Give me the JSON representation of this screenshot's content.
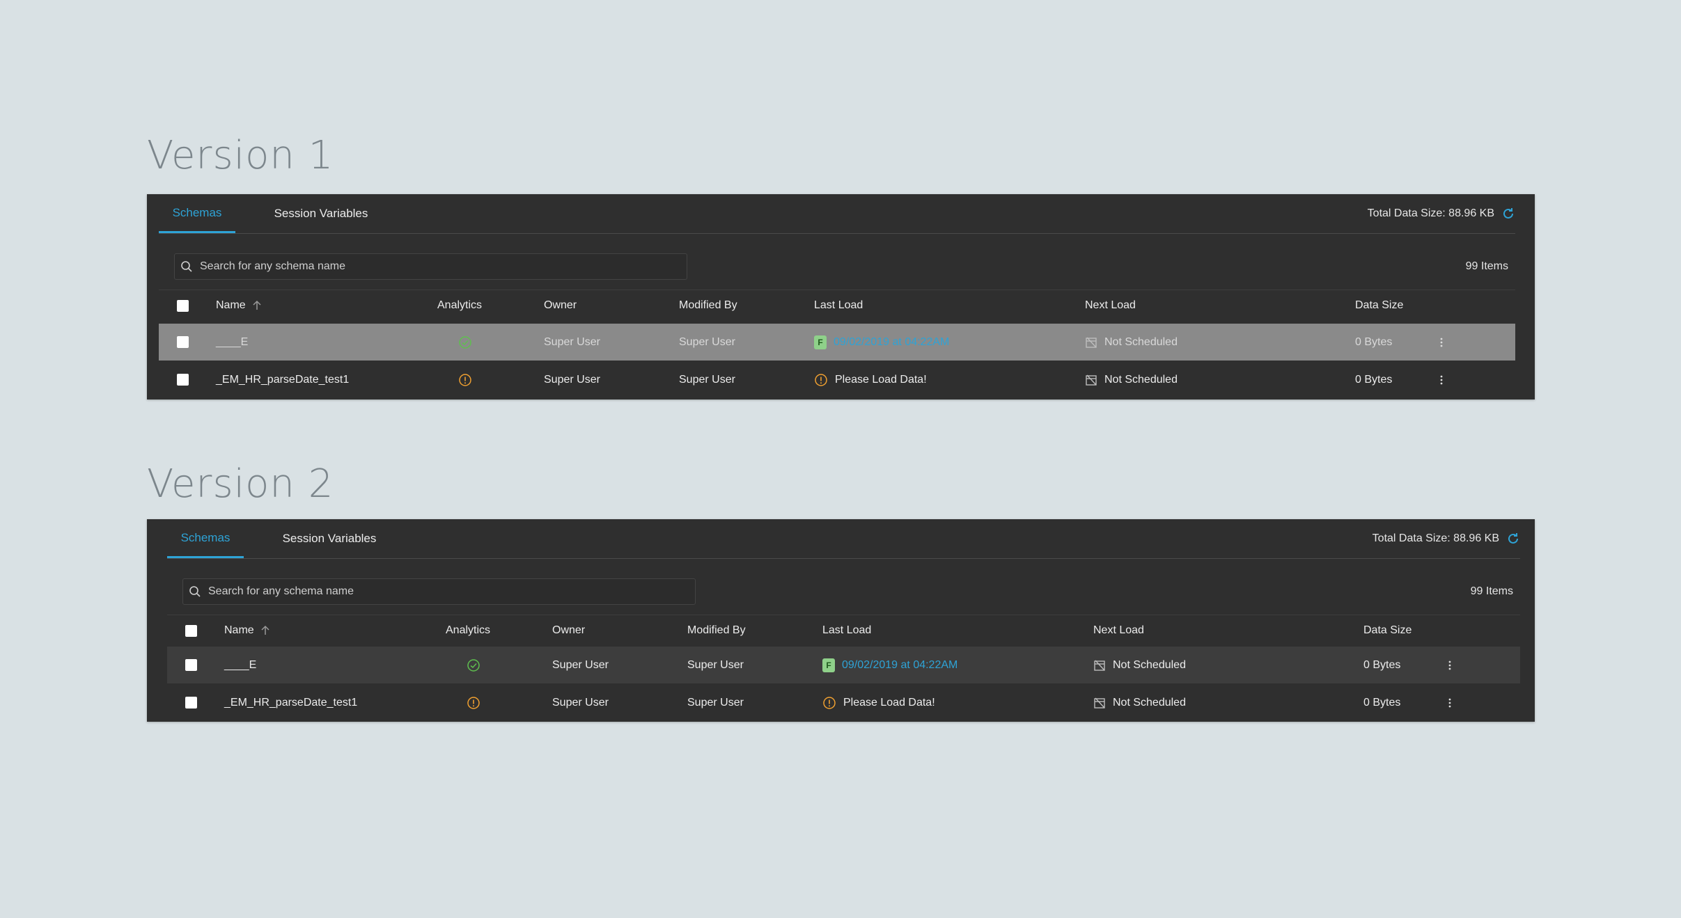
{
  "versions": [
    {
      "title": "Version 1",
      "tabs": [
        "Schemas",
        "Session Variables"
      ],
      "total_size": "Total Data Size: 88.96 KB",
      "search_placeholder": "Search for any schema name",
      "items_count": "99 Items",
      "columns": {
        "name": "Name",
        "analytics": "Analytics",
        "owner": "Owner",
        "modified_by": "Modified By",
        "last_load": "Last Load",
        "next_load": "Next Load",
        "data_size": "Data Size"
      },
      "rows": [
        {
          "name": "____E",
          "analytics_status": "check-circle-icon",
          "owner": "Super User",
          "modified_by": "Super User",
          "last_load_icon_letter": "F",
          "last_load": "09/02/2019 at 04:22AM",
          "next_load": "Not Scheduled",
          "data_size": "0 Bytes"
        },
        {
          "name": "_EM_HR_parseDate_test1",
          "analytics_status": "warning-circle-icon",
          "owner": "Super User",
          "modified_by": "Super User",
          "last_load": "Please Load Data!",
          "next_load": "Not Scheduled",
          "data_size": "0 Bytes"
        }
      ]
    },
    {
      "title": "Version 2",
      "tabs": [
        "Schemas",
        "Session Variables"
      ],
      "total_size": "Total Data Size: 88.96 KB",
      "search_placeholder": "Search for any schema name",
      "items_count": "99 Items",
      "columns": {
        "name": "Name",
        "analytics": "Analytics",
        "owner": "Owner",
        "modified_by": "Modified By",
        "last_load": "Last Load",
        "next_load": "Next Load",
        "data_size": "Data Size"
      },
      "rows": [
        {
          "name": "____E",
          "analytics_status": "check-circle-icon",
          "owner": "Super User",
          "modified_by": "Super User",
          "last_load_icon_letter": "F",
          "last_load": "09/02/2019 at 04:22AM",
          "next_load": "Not Scheduled",
          "data_size": "0 Bytes"
        },
        {
          "name": "_EM_HR_parseDate_test1",
          "analytics_status": "warning-circle-icon",
          "owner": "Super User",
          "modified_by": "Super User",
          "last_load": "Please Load Data!",
          "next_load": "Not Scheduled",
          "data_size": "0 Bytes"
        }
      ]
    }
  ],
  "colors": {
    "background": "#d9e1e4",
    "panel": "#2f2f2f",
    "accent": "#2ea3d6",
    "success": "#5fbf4f",
    "warning": "#f0a030",
    "v1_selected_row": "#8a8a8a",
    "v2_selected_row": "#3d3d3d"
  }
}
